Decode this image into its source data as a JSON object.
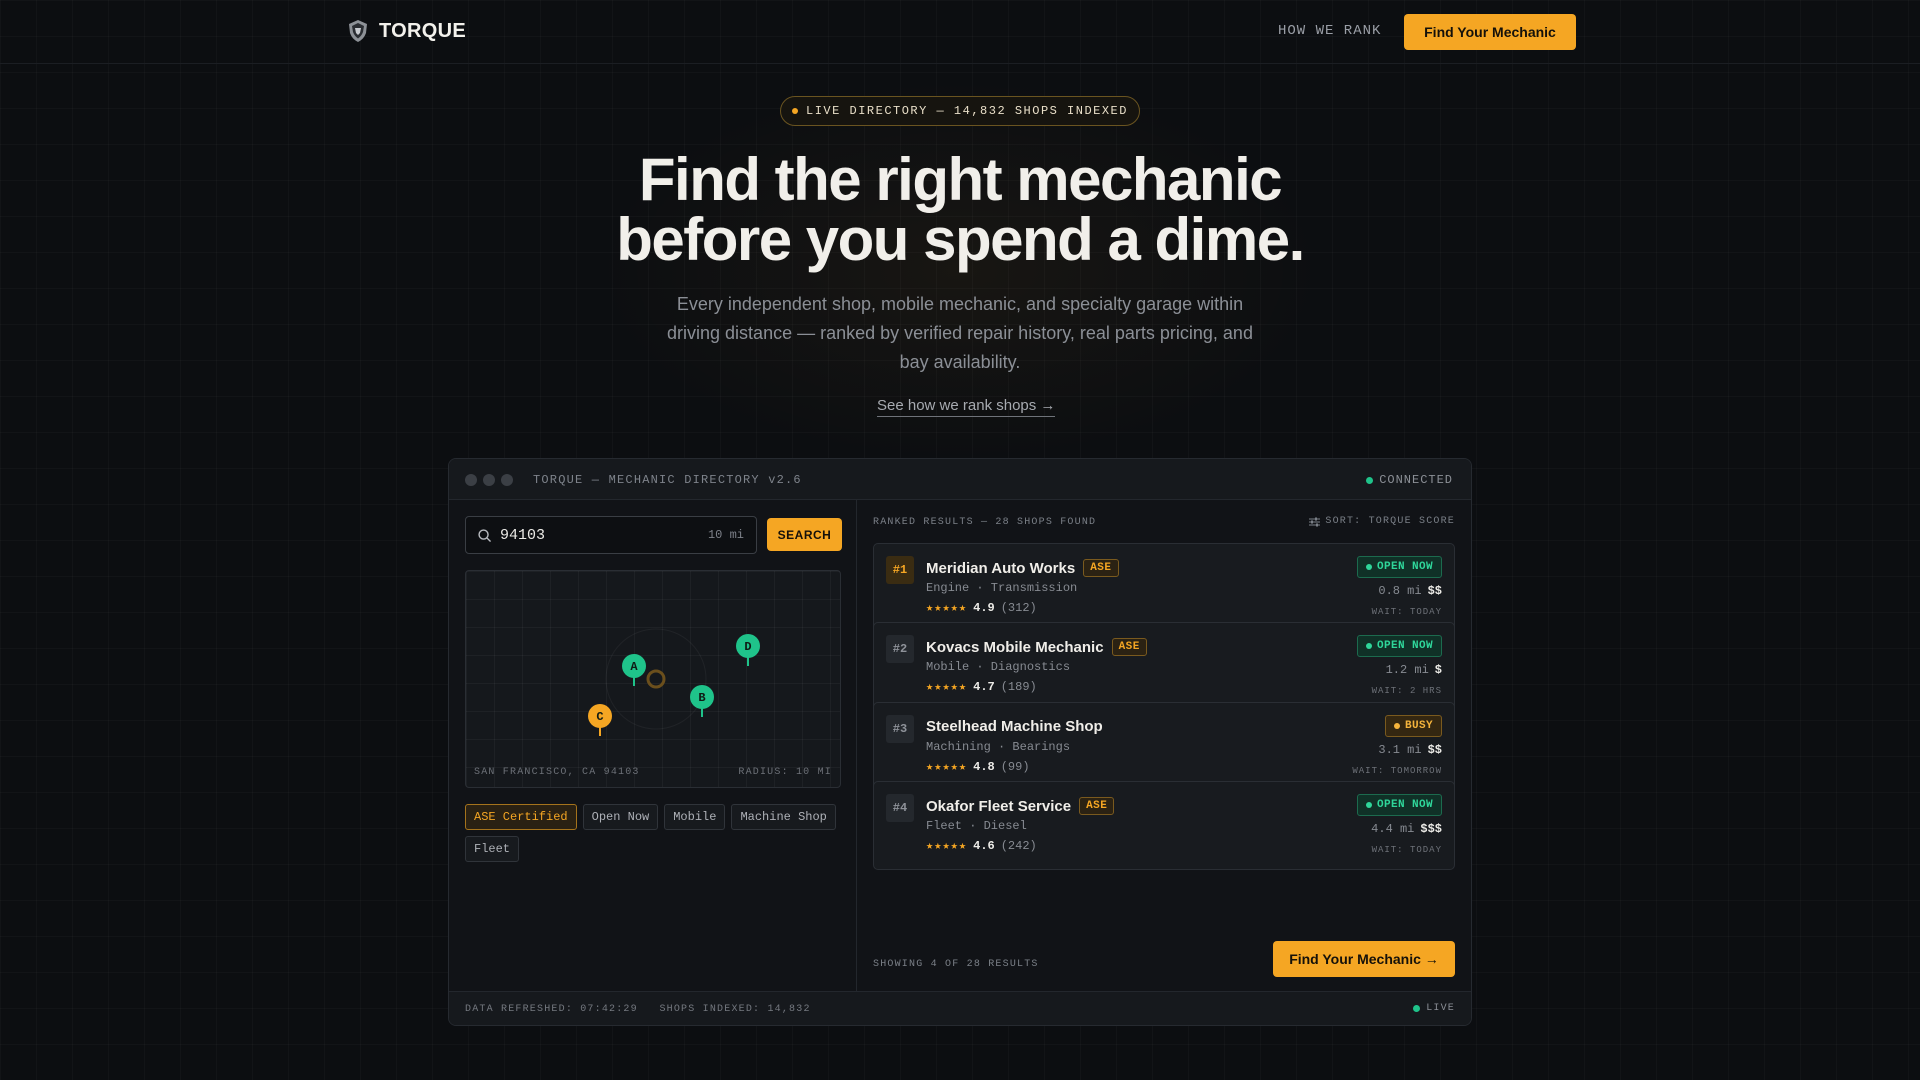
{
  "colors": {
    "accent": "#f5a623",
    "open": "#1fc38a",
    "background": "#0c0e11"
  },
  "nav": {
    "brand": "TORQUE",
    "logo_icon": "helmet-shield-icon",
    "how_we_rank": "HOW WE RANK",
    "cta": "Find Your Mechanic"
  },
  "hero": {
    "pill": "LIVE DIRECTORY — 14,832 SHOPS INDEXED",
    "title_line1": "Find the right mechanic",
    "title_line2": "before you spend a dime.",
    "subtitle": "Every independent shop, mobile mechanic, and specialty garage within driving distance — ranked by verified repair history, real parts pricing, and bay availability.",
    "link": "See how we rank shops →"
  },
  "window": {
    "title": "TORQUE — MECHANIC DIRECTORY v2.6",
    "status": "CONNECTED"
  },
  "search": {
    "value": "94103",
    "radius": "10 mi",
    "button": "SEARCH"
  },
  "map": {
    "location": "SAN FRANCISCO, CA 94103",
    "radius_label": "RADIUS: 10 MI",
    "pins": [
      {
        "label": "A",
        "color": "#1fc38a"
      },
      {
        "label": "B",
        "color": "#1fc38a"
      },
      {
        "label": "C",
        "color": "#f5a623"
      },
      {
        "label": "D",
        "color": "#1fc38a"
      }
    ]
  },
  "filters": [
    {
      "label": "ASE Certified",
      "active": true
    },
    {
      "label": "Open Now",
      "active": false
    },
    {
      "label": "Mobile",
      "active": false
    },
    {
      "label": "Machine Shop",
      "active": false
    },
    {
      "label": "Fleet",
      "active": false
    }
  ],
  "results": {
    "header": "RANKED RESULTS — 28 SHOPS FOUND",
    "sort": "SORT: TORQUE SCORE",
    "showing": "SHOWING 4 OF 28 RESULTS",
    "cta": "Find Your Mechanic →",
    "shops": [
      {
        "rank": "#1",
        "name": "Meridian Auto Works",
        "ase": "ASE",
        "spec": "Engine · Transmission",
        "stars": "★★★★★",
        "score": "4.9",
        "reviews": "(312)",
        "status": "OPEN NOW",
        "status_type": "open",
        "dist": "0.8 mi",
        "price": "$$",
        "wait": "WAIT: TODAY"
      },
      {
        "rank": "#2",
        "name": "Kovacs Mobile Mechanic",
        "ase": "ASE",
        "spec": "Mobile · Diagnostics",
        "stars": "★★★★★",
        "score": "4.7",
        "reviews": "(189)",
        "status": "OPEN NOW",
        "status_type": "open",
        "dist": "1.2 mi",
        "price": "$",
        "wait": "WAIT: 2 HRS"
      },
      {
        "rank": "#3",
        "name": "Steelhead Machine Shop",
        "ase": "",
        "spec": "Machining · Bearings",
        "stars": "★★★★★",
        "score": "4.8",
        "reviews": "(99)",
        "status": "BUSY",
        "status_type": "busy",
        "dist": "3.1 mi",
        "price": "$$",
        "wait": "WAIT: TOMORROW"
      },
      {
        "rank": "#4",
        "name": "Okafor Fleet Service",
        "ase": "ASE",
        "spec": "Fleet · Diesel",
        "stars": "★★★★★",
        "score": "4.6",
        "reviews": "(242)",
        "status": "OPEN NOW",
        "status_type": "open",
        "dist": "4.4 mi",
        "price": "$$$",
        "wait": "WAIT: TODAY"
      }
    ]
  },
  "footer": {
    "refreshed": "DATA REFRESHED: 07:42:29",
    "indexed": "SHOPS INDEXED: 14,832",
    "live": "LIVE"
  }
}
